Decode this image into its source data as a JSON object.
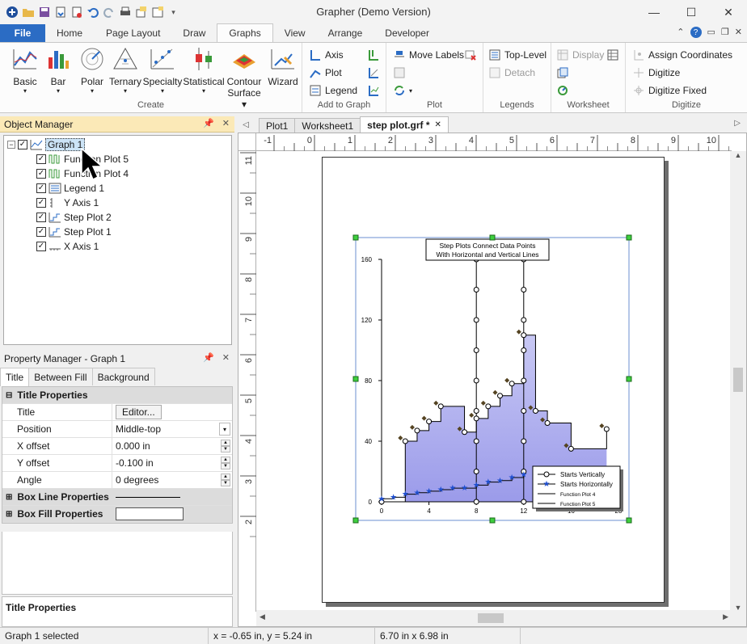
{
  "app": {
    "title": "Grapher (Demo Version)"
  },
  "window": {
    "minimize": "—",
    "maximize": "☐",
    "close": "✕"
  },
  "tabs": {
    "file": "File",
    "home": "Home",
    "page_layout": "Page Layout",
    "draw": "Draw",
    "graphs": "Graphs",
    "view": "View",
    "arrange": "Arrange",
    "developer": "Developer"
  },
  "ribbon": {
    "create": {
      "label": "Create",
      "basic": "Basic",
      "bar": "Bar",
      "polar": "Polar",
      "ternary": "Ternary",
      "specialty": "Specialty",
      "statistical": "Statistical",
      "contour1": "Contour",
      "contour2": "Surface",
      "wizard": "Wizard"
    },
    "add_to_graph": {
      "label": "Add to Graph",
      "axis": "Axis",
      "plot": "Plot",
      "legend": "Legend"
    },
    "plot": {
      "label": "Plot",
      "move_labels": "Move Labels"
    },
    "legends": {
      "label": "Legends",
      "top_level": "Top-Level",
      "detach": "Detach"
    },
    "worksheet": {
      "label": "Worksheet",
      "display": "Display"
    },
    "digitize": {
      "label": "Digitize",
      "assign": "Assign Coordinates",
      "digitize": "Digitize",
      "digitize_fixed": "Digitize Fixed"
    }
  },
  "object_manager": {
    "title": "Object Manager",
    "items": [
      {
        "label": "Graph 1"
      },
      {
        "label": "Function Plot 5"
      },
      {
        "label": "Function Plot 4"
      },
      {
        "label": "Legend 1"
      },
      {
        "label": "Y Axis 1"
      },
      {
        "label": "Step Plot 2"
      },
      {
        "label": "Step Plot 1"
      },
      {
        "label": "X Axis 1"
      }
    ]
  },
  "property_manager": {
    "title": "Property Manager - Graph 1",
    "tabs": [
      "Title",
      "Between Fill",
      "Background"
    ],
    "section_title": "Title Properties",
    "rows": [
      {
        "key": "Title",
        "value": "Editor..."
      },
      {
        "key": "Position",
        "value": "Middle-top"
      },
      {
        "key": "X offset",
        "value": "0.000 in"
      },
      {
        "key": "Y offset",
        "value": "-0.100 in"
      },
      {
        "key": "Angle",
        "value": "0 degrees"
      }
    ],
    "box_line": "Box Line Properties",
    "box_fill": "Box Fill Properties",
    "help_title": "Title Properties"
  },
  "doc_tabs": [
    "Plot1",
    "Worksheet1",
    "step plot.grf *"
  ],
  "hruler_labels": [
    "-1",
    "0",
    "1",
    "2",
    "3",
    "4",
    "5",
    "6",
    "7",
    "8",
    "9",
    "10"
  ],
  "vruler_labels": [
    "11",
    "10",
    "9",
    "8",
    "7",
    "6",
    "5",
    "4",
    "3",
    "2"
  ],
  "chart_data": {
    "type": "line",
    "title": "Step Plots Connect Data Points\nWith Horizontal and Vertical Lines",
    "title_line1": "Step Plots Connect Data Points",
    "title_line2": "With Horizontal and Vertical Lines",
    "xlim": [
      0,
      20
    ],
    "ylim": [
      0,
      160
    ],
    "x_ticks": [
      0,
      4,
      8,
      12,
      16,
      20
    ],
    "y_ticks": [
      0,
      40,
      80,
      120,
      160
    ],
    "legend_position": "bottom-right",
    "series": [
      {
        "name": "Starts Vertically",
        "x": [
          0,
          2,
          3,
          4,
          5,
          7,
          8,
          9,
          10,
          11,
          12,
          13,
          14,
          16,
          19
        ],
        "y": [
          0,
          40,
          47,
          53,
          63,
          46,
          55,
          63,
          70,
          78,
          110,
          60,
          52,
          35,
          48
        ]
      },
      {
        "name": "Starts Horizontally",
        "x": [
          0,
          1,
          2,
          3,
          4,
          5,
          6,
          7,
          8,
          9,
          10,
          11,
          12
        ],
        "y": [
          2,
          3,
          5,
          6,
          7,
          8,
          9,
          9,
          11,
          13,
          14,
          16,
          18
        ]
      },
      {
        "name": "Function Plot 4",
        "x": [
          8,
          8
        ],
        "y": [
          0,
          160
        ]
      },
      {
        "name": "Function Plot 5",
        "x": [
          12,
          12
        ],
        "y": [
          0,
          160
        ]
      }
    ]
  },
  "status": {
    "selection": "Graph 1 selected",
    "coords": "x = -0.65 in, y = 5.24 in",
    "size": "6.70 in x 6.98 in"
  }
}
